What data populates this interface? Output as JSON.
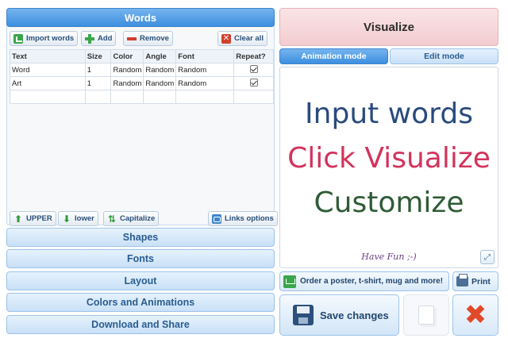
{
  "words_panel": {
    "title": "Words",
    "toolbar": {
      "import_label": "Import words",
      "add_label": "Add",
      "remove_label": "Remove",
      "clear_label": "Clear all"
    },
    "table": {
      "columns": [
        "Text",
        "Size",
        "Color",
        "Angle",
        "Font",
        "Repeat?"
      ],
      "rows": [
        {
          "text": "Word",
          "size": "1",
          "color": "Random",
          "angle": "Random",
          "font": "Random",
          "repeat": true
        },
        {
          "text": "Art",
          "size": "1",
          "color": "Random",
          "angle": "Random",
          "font": "Random",
          "repeat": true
        }
      ]
    },
    "case_buttons": {
      "upper_label": "UPPER",
      "lower_label": "lower",
      "capitalize_label": "Capitalize",
      "links_label": "Links options"
    }
  },
  "sections": {
    "shapes": "Shapes",
    "fonts": "Fonts",
    "layout": "Layout",
    "colors": "Colors and Animations",
    "download": "Download and Share"
  },
  "right_panel": {
    "visualize_label": "Visualize",
    "tabs": {
      "animation": "Animation mode",
      "edit": "Edit mode",
      "active": "animation"
    },
    "preview": {
      "line1": "Input words",
      "line2": "Click Visualize",
      "line3": "Customize",
      "signature": "Have Fun ;-)"
    },
    "order_label": "Order a poster, t-shirt, mug and more!",
    "print_label": "Print",
    "save_label": "Save changes"
  },
  "icons": {
    "import": "import-icon",
    "add": "plus-icon",
    "remove": "minus-icon",
    "clear": "clear-icon",
    "upper": "arrow-up-icon",
    "lower": "arrow-down-icon",
    "capitalize": "capitalize-icon",
    "links": "link-icon",
    "fullscreen": "fullscreen-icon",
    "order": "cart-icon",
    "print": "printer-icon",
    "save": "floppy-disk-icon",
    "copy": "copy-icon",
    "delete": "delete-x-icon"
  },
  "colors": {
    "accent_blue": "#3d8fdf",
    "visualize_pink": "#f2ccd0",
    "preview_line1": "#2a4a7c",
    "preview_line2": "#d2345c",
    "preview_line3": "#2e5b36",
    "delete_red": "#e04a2a"
  }
}
